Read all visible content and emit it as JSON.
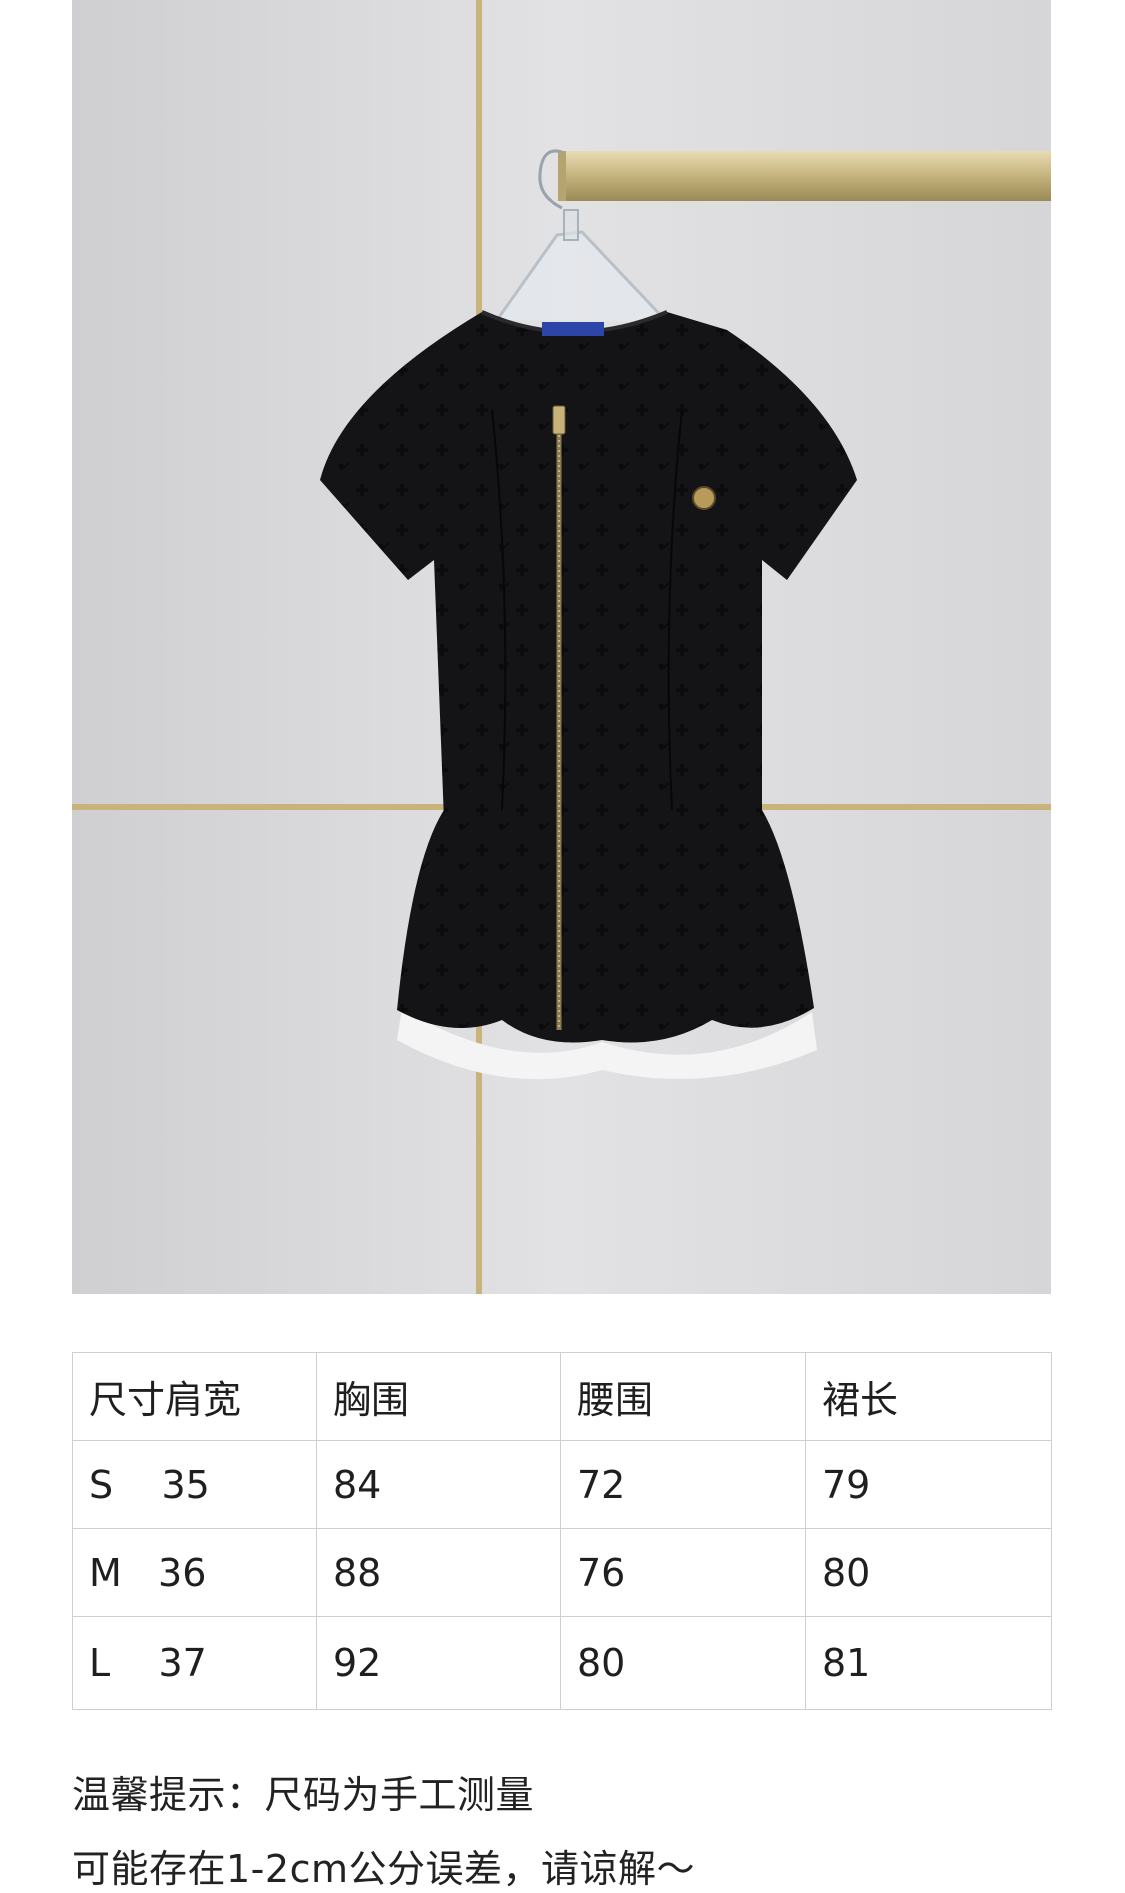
{
  "product_photo": {
    "alt": "",
    "label_tag": "",
    "colors": {
      "wall": "#d9d9dc",
      "trim": "#c8b37a",
      "dress": "#141416",
      "lining": "#f4f4f4"
    }
  },
  "size_table": {
    "headers": [
      "尺寸肩宽",
      "胸围",
      "腰围",
      "裙长"
    ],
    "rows": [
      [
        "S    35",
        "84",
        "72",
        "79"
      ],
      [
        "M   36",
        "88",
        "76",
        "80"
      ],
      [
        "L    37",
        "92",
        "80",
        "81"
      ]
    ]
  },
  "note": {
    "line1": "温馨提示：尺码为手工测量",
    "line2": "可能存在1-2cm公分误差，请谅解～"
  }
}
